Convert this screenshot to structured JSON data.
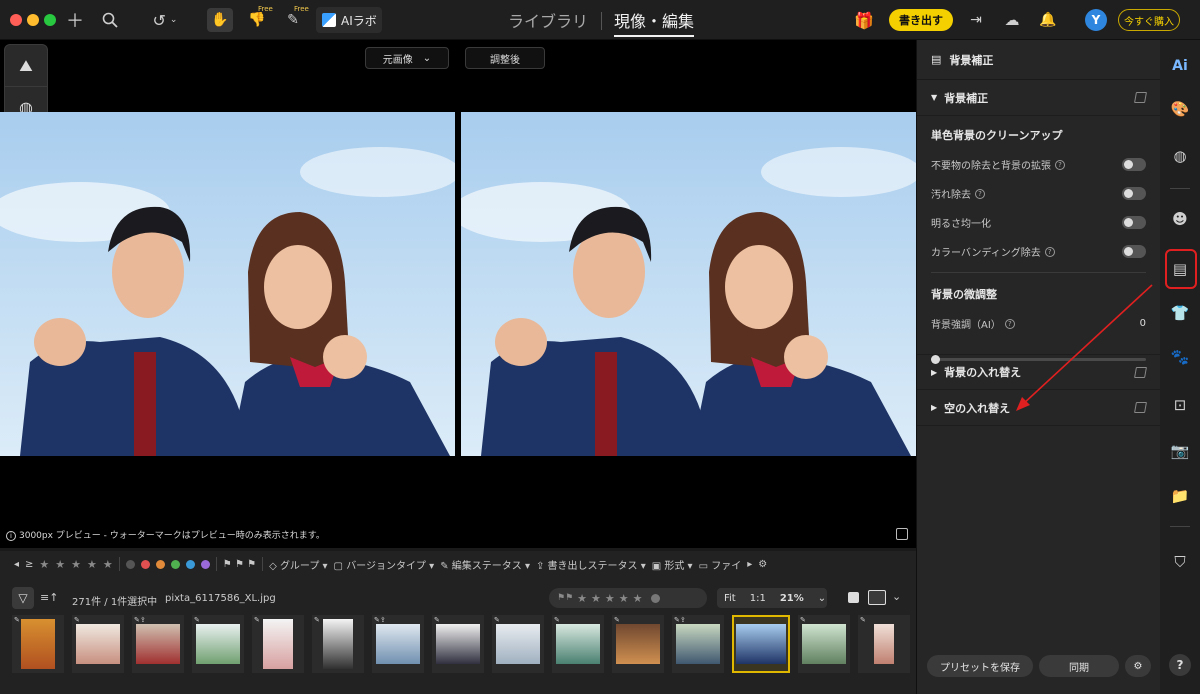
{
  "topbar": {
    "ai_lab_label": "AIラボ",
    "free_label": "Free",
    "nav_library": "ライブラリ",
    "nav_develop": "現像・編集",
    "export_label": "書き出す",
    "avatar_initial": "Y",
    "buy_label": "今すぐ購入"
  },
  "preview": {
    "view_select_label": "元画像",
    "view_after_label": "調整後",
    "note_text": "3000px プレビュー - ウォーターマークはプレビュー時のみ表示されます。"
  },
  "filmstrip": {
    "filter_ge": "≥",
    "filters": [
      "グループ",
      "バージョンタイプ",
      "編集ステータス",
      "書き出しステータス",
      "形式",
      "ファイ"
    ],
    "count_text": "271件 / 1件選択中",
    "filename": "pixta_6117586_XL.jpg",
    "zoom_fit": "Fit",
    "zoom_1to1": "1:1",
    "zoom_value": "21%",
    "label_colors": [
      "#555555",
      "#e05050",
      "#e08a3a",
      "#50b050",
      "#3a9ad8",
      "#9a6ad8"
    ]
  },
  "panel": {
    "header": "背景補正",
    "section_bg": "背景補正",
    "sub_cleanup": "単色背景のクリーンアップ",
    "opt_remove": "不要物の除去と背景の拡張",
    "opt_stain": "汚れ除去",
    "opt_brightness": "明るさ均一化",
    "opt_banding": "カラーバンディング除去",
    "sub_fine": "背景の微調整",
    "slider_label": "背景強調（AI）",
    "slider_value": "0",
    "section_replace_bg": "背景の入れ替え",
    "section_replace_sky": "空の入れ替え",
    "save_preset": "プリセットを保存",
    "sync": "同期"
  },
  "rail": {
    "ai_label": "Ai",
    "help_label": "?",
    "highlight_color": "#e02020"
  }
}
